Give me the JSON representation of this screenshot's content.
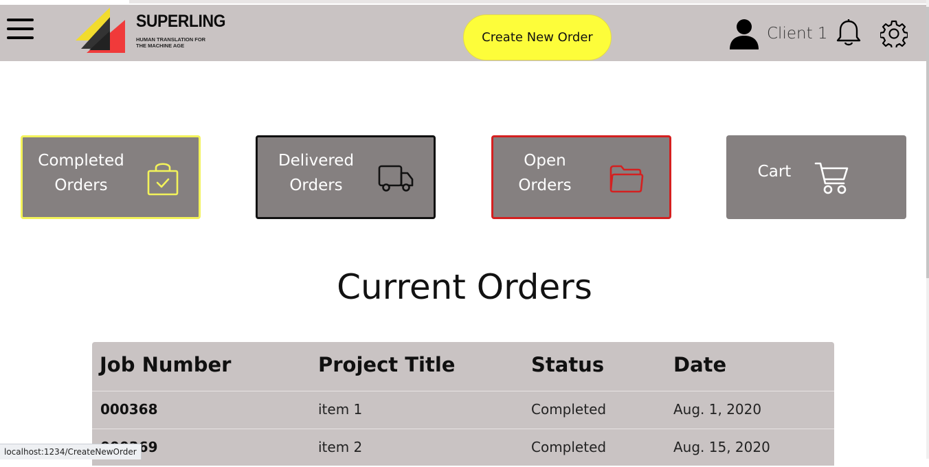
{
  "header": {
    "brand_name": "SUPERLING",
    "brand_tagline_line1": "HUMAN TRANSLATION FOR",
    "brand_tagline_line2": "THE MACHINE AGE",
    "create_button_label": "Create New Order",
    "user_name": "Client 1"
  },
  "cards": {
    "completed": {
      "line1": "Completed",
      "line2": "Orders",
      "icon": "shopping-bag-check-icon",
      "accent": "#f3f35a"
    },
    "delivered": {
      "line1": "Delivered",
      "line2": "Orders",
      "icon": "truck-icon",
      "accent": "#101010"
    },
    "open": {
      "line1": "Open",
      "line2": "Orders",
      "icon": "folder-open-icon",
      "accent": "#d42020"
    },
    "cart": {
      "line1": "Cart",
      "icon": "cart-icon"
    }
  },
  "section_title": "Current Orders",
  "table": {
    "columns": [
      "Job Number",
      "Project Title",
      "Status",
      "Date"
    ],
    "rows": [
      {
        "job": "000368",
        "title": "item 1",
        "status": "Completed",
        "date": "Aug. 1, 2020"
      },
      {
        "job": "000369",
        "title": "item 2",
        "status": "Completed",
        "date": "Aug. 15, 2020"
      }
    ]
  },
  "status_bar_url": "localhost:1234/CreateNewOrder",
  "colors": {
    "header_bg": "#c9c3c3",
    "create_button_bg": "#fdfd3a",
    "card_bg": "#858080"
  }
}
